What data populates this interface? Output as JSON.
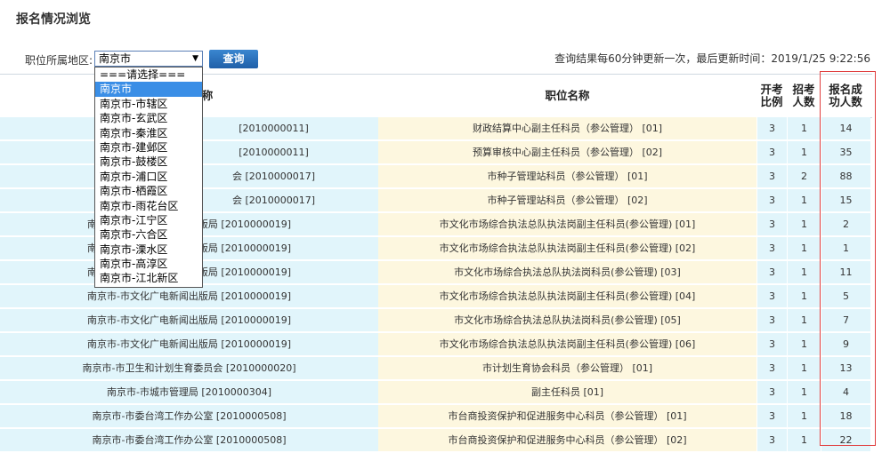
{
  "page": {
    "title": "报名情况浏览"
  },
  "filter": {
    "label": "职位所属地区:",
    "selected_value": "南京市",
    "query_button": "查询",
    "options": [
      "===请选择===",
      "南京市",
      "南京市-市辖区",
      "南京市-玄武区",
      "南京市-秦淮区",
      "南京市-建邺区",
      "南京市-鼓楼区",
      "南京市-浦口区",
      "南京市-栖霞区",
      "南京市-雨花台区",
      "南京市-江宁区",
      "南京市-六合区",
      "南京市-溧水区",
      "南京市-高淳区",
      "南京市-江北新区"
    ],
    "selected_index": 1
  },
  "update_note": "查询结果每60分钟更新一次，最后更新时间：2019/1/25 9:22:56",
  "table": {
    "headers": {
      "unit": "称",
      "position": "职位名称",
      "ratio": "开考\n比例",
      "hire": "招考\n人数",
      "success": "报名成\n功人数"
    },
    "rows": [
      {
        "unit": "[2010000011]",
        "position": "财政结算中心副主任科员（参公管理）  [01]",
        "ratio": "3",
        "hire": "1",
        "success": "14"
      },
      {
        "unit": "[2010000011]",
        "position": "预算审核中心副主任科员（参公管理）  [02]",
        "ratio": "3",
        "hire": "1",
        "success": "35"
      },
      {
        "unit": "会 [2010000017]",
        "position": "市种子管理站科员（参公管理）  [01]",
        "ratio": "3",
        "hire": "2",
        "success": "88"
      },
      {
        "unit": "会 [2010000017]",
        "position": "市种子管理站科员（参公管理）  [02]",
        "ratio": "3",
        "hire": "1",
        "success": "15"
      },
      {
        "unit": "南京市-市文化广电新闻出版局 [2010000019]",
        "position": "市文化市场综合执法总队执法岗副主任科员(参公管理) [01]",
        "ratio": "3",
        "hire": "1",
        "success": "2"
      },
      {
        "unit": "南京市-市文化广电新闻出版局 [2010000019]",
        "position": "市文化市场综合执法总队执法岗副主任科员(参公管理) [02]",
        "ratio": "3",
        "hire": "1",
        "success": "1"
      },
      {
        "unit": "南京市-市文化广电新闻出版局 [2010000019]",
        "position": "市文化市场综合执法总队执法岗科员(参公管理) [03]",
        "ratio": "3",
        "hire": "1",
        "success": "11"
      },
      {
        "unit": "南京市-市文化广电新闻出版局 [2010000019]",
        "position": "市文化市场综合执法总队执法岗副主任科员(参公管理) [04]",
        "ratio": "3",
        "hire": "1",
        "success": "5"
      },
      {
        "unit": "南京市-市文化广电新闻出版局 [2010000019]",
        "position": "市文化市场综合执法总队执法岗科员(参公管理) [05]",
        "ratio": "3",
        "hire": "1",
        "success": "7"
      },
      {
        "unit": "南京市-市文化广电新闻出版局 [2010000019]",
        "position": "市文化市场综合执法总队执法岗副主任科员(参公管理) [06]",
        "ratio": "3",
        "hire": "1",
        "success": "9"
      },
      {
        "unit": "南京市-市卫生和计划生育委员会 [2010000020]",
        "position": "市计划生育协会科员（参公管理）  [01]",
        "ratio": "3",
        "hire": "1",
        "success": "13"
      },
      {
        "unit": "南京市-市城市管理局 [2010000304]",
        "position": "副主任科员 [01]",
        "ratio": "3",
        "hire": "1",
        "success": "4"
      },
      {
        "unit": "南京市-市委台湾工作办公室 [2010000508]",
        "position": "市台商投资保护和促进服务中心科员（参公管理）  [01]",
        "ratio": "3",
        "hire": "1",
        "success": "18"
      },
      {
        "unit": "南京市-市委台湾工作办公室 [2010000508]",
        "position": "市台商投资保护和促进服务中心科员（参公管理）  [02]",
        "ratio": "3",
        "hire": "1",
        "success": "22"
      }
    ]
  },
  "colors": {
    "unit_bg": "#e1f5fb",
    "position_bg": "#fdf7df",
    "highlight": "#e04040",
    "button": "#2b74bf"
  }
}
